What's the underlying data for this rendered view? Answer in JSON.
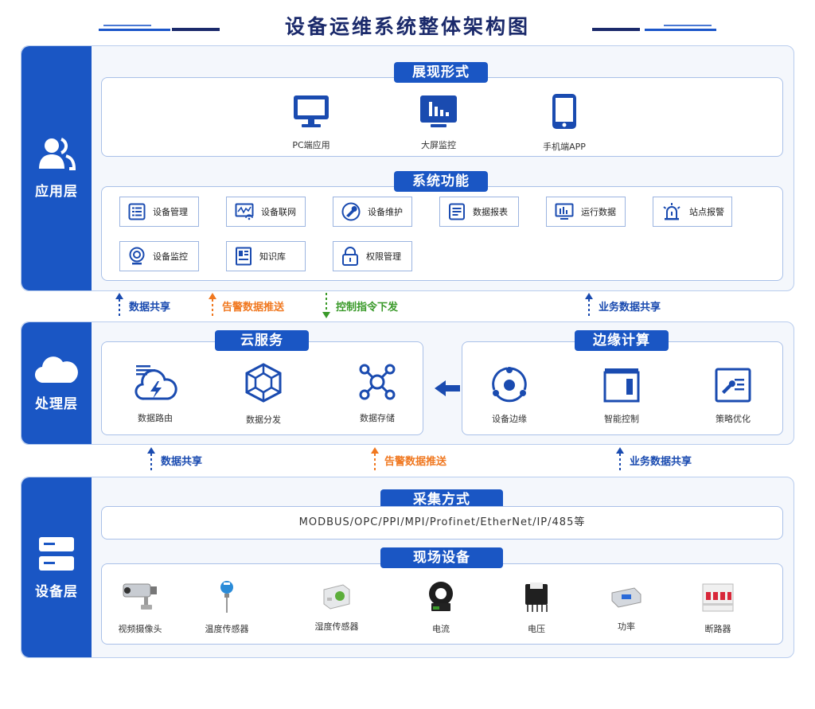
{
  "title": "设备运维系统整体架构图",
  "colors": {
    "primary": "#1a56c4",
    "orange": "#f07820",
    "green": "#3a9a2a",
    "border": "#a9c0e8"
  },
  "application_layer": {
    "name": "应用层",
    "icon": "users-icon",
    "display": {
      "title": "展现形式",
      "items": [
        {
          "label": "PC端应用",
          "icon": "monitor-icon"
        },
        {
          "label": "大屏监控",
          "icon": "bigscreen-icon"
        },
        {
          "label": "手机端APP",
          "icon": "phone-icon"
        }
      ]
    },
    "functions": {
      "title": "系统功能",
      "items": [
        {
          "label": "设备管理",
          "icon": "list-icon"
        },
        {
          "label": "设备联网",
          "icon": "network-icon"
        },
        {
          "label": "设备维护",
          "icon": "wrench-icon"
        },
        {
          "label": "数据报表",
          "icon": "report-icon"
        },
        {
          "label": "运行数据",
          "icon": "chart-icon"
        },
        {
          "label": "站点报警",
          "icon": "alarm-icon"
        },
        {
          "label": "设备监控",
          "icon": "camera-icon"
        },
        {
          "label": "知识库",
          "icon": "book-icon"
        },
        {
          "label": "权限管理",
          "icon": "lock-icon"
        }
      ]
    }
  },
  "flows_top": [
    {
      "label": "数据共享",
      "direction": "up",
      "color": "blue"
    },
    {
      "label": "告警数据推送",
      "direction": "up",
      "color": "orange"
    },
    {
      "label": "控制指令下发",
      "direction": "down",
      "color": "green"
    },
    {
      "label": "业务数据共享",
      "direction": "up",
      "color": "blue"
    }
  ],
  "processing_layer": {
    "name": "处理层",
    "icon": "cloud-icon",
    "cloud": {
      "title": "云服务",
      "items": [
        {
          "label": "数据路由",
          "icon": "cloud-bolt-icon"
        },
        {
          "label": "数据分发",
          "icon": "hexagon-network-icon"
        },
        {
          "label": "数据存储",
          "icon": "nodes-icon"
        }
      ]
    },
    "edge": {
      "title": "边缘计算",
      "items": [
        {
          "label": "设备边缘",
          "icon": "edge-icon"
        },
        {
          "label": "智能控制",
          "icon": "control-icon"
        },
        {
          "label": "策略优化",
          "icon": "strategy-icon"
        }
      ]
    }
  },
  "flows_bottom": [
    {
      "label": "数据共享",
      "direction": "up",
      "color": "blue"
    },
    {
      "label": "告警数据推送",
      "direction": "up",
      "color": "orange"
    },
    {
      "label": "业务数据共享",
      "direction": "up",
      "color": "blue"
    }
  ],
  "device_layer": {
    "name": "设备层",
    "icon": "server-icon",
    "collection": {
      "title": "采集方式",
      "protocols": "MODBUS/OPC/PPI/MPI/Profinet/EtherNet/IP/485等"
    },
    "field": {
      "title": "现场设备",
      "items": [
        {
          "label": "视频摄像头",
          "icon": "cctv-icon"
        },
        {
          "label": "温度传感器",
          "icon": "temperature-sensor-icon"
        },
        {
          "label": "湿度传感器",
          "icon": "humidity-sensor-icon"
        },
        {
          "label": "电流",
          "icon": "current-sensor-icon"
        },
        {
          "label": "电压",
          "icon": "voltage-module-icon"
        },
        {
          "label": "功率",
          "icon": "power-meter-icon"
        },
        {
          "label": "断路器",
          "icon": "breaker-icon"
        }
      ]
    }
  }
}
